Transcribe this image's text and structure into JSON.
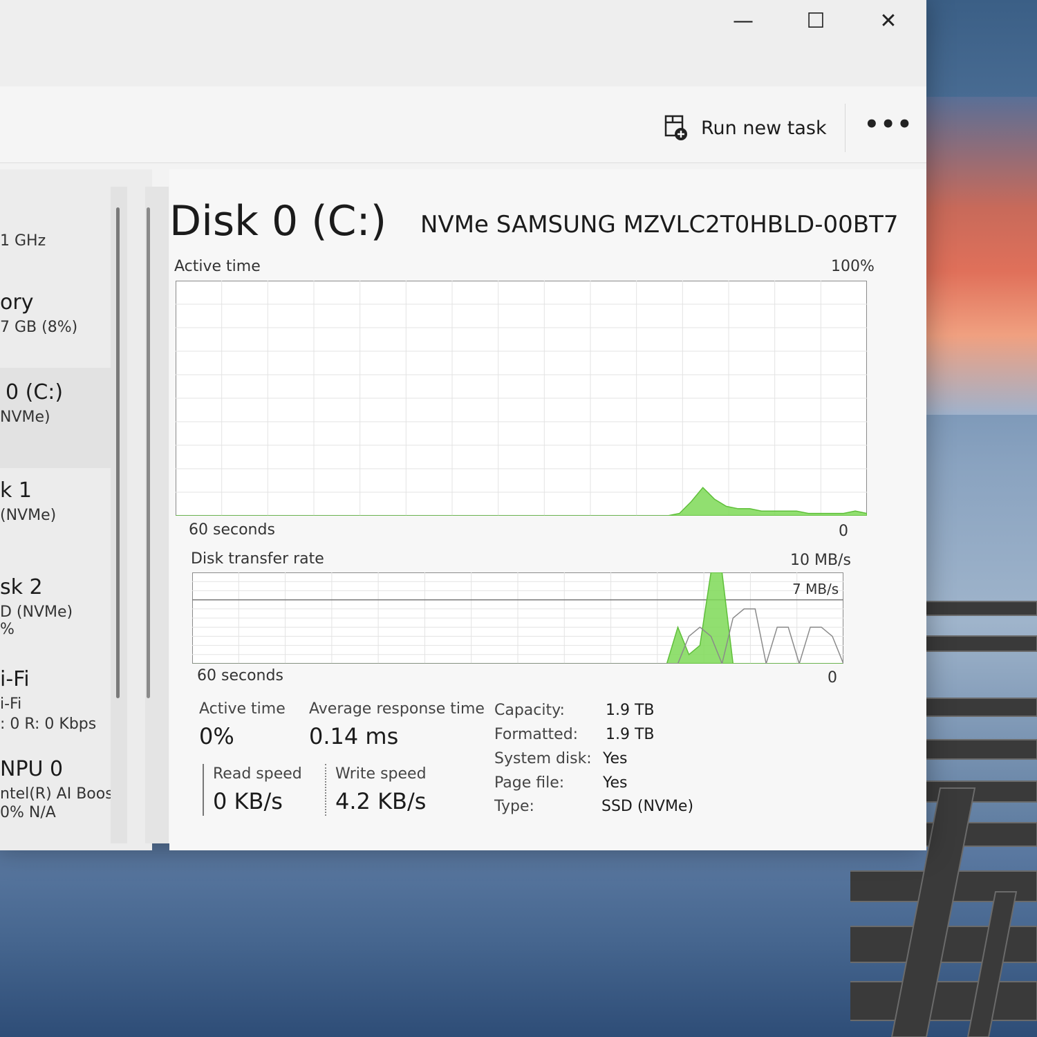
{
  "toolbar": {
    "run_new_task": "Run new task",
    "more": "•••"
  },
  "window_controls": {
    "minimize": "—",
    "maximize": "☐",
    "close": "✕"
  },
  "sidebar": {
    "items": [
      {
        "title": "",
        "sub": "1 GHz"
      },
      {
        "title": "ory",
        "sub": "7 GB (8%)"
      },
      {
        "title": "0 (C:)",
        "sub": "NVMe)"
      },
      {
        "title": "k 1",
        "sub": "(NVMe)"
      },
      {
        "title": "sk 2",
        "sub": "D (NVMe)",
        "sub2": "%"
      },
      {
        "title": "i-Fi",
        "sub": "i-Fi",
        "sub2": ": 0 R: 0 Kbps"
      },
      {
        "title": "NPU 0",
        "sub": "ntel(R) AI Boost",
        "sub2": "0% N/A"
      }
    ]
  },
  "header": {
    "title": "Disk 0 (C:)",
    "model": "NVMe SAMSUNG MZVLC2T0HBLD-00BT7"
  },
  "active_chart": {
    "label": "Active time",
    "max_label": "100%",
    "time_left": "60 seconds",
    "time_right": "0",
    "color": "#7ed957"
  },
  "transfer_chart": {
    "label": "Disk transfer rate",
    "max_label": "10 MB/s",
    "ref_label": "7 MB/s",
    "time_left": "60 seconds",
    "time_right": "0",
    "color": "#7ed957"
  },
  "stats": {
    "active_time_label": "Active time",
    "active_time_value": "0%",
    "avg_response_label": "Average response time",
    "avg_response_value": "0.14 ms",
    "read_label": "Read speed",
    "read_value": "0 KB/s",
    "write_label": "Write speed",
    "write_value": "4.2 KB/s"
  },
  "info": {
    "capacity_label": "Capacity:",
    "capacity_value": "1.9 TB",
    "formatted_label": "Formatted:",
    "formatted_value": "1.9 TB",
    "system_label": "System disk:",
    "system_value": "Yes",
    "pagefile_label": "Page file:",
    "pagefile_value": "Yes",
    "type_label": "Type:",
    "type_value": "SSD (NVMe)"
  },
  "chart_data": [
    {
      "type": "area",
      "title": "Active time",
      "ylim": [
        0,
        100
      ],
      "x_range_seconds": [
        60,
        0
      ],
      "values": [
        0,
        0,
        0,
        0,
        0,
        0,
        0,
        0,
        0,
        0,
        0,
        0,
        0,
        0,
        0,
        0,
        0,
        0,
        0,
        0,
        0,
        0,
        0,
        0,
        0,
        0,
        0,
        0,
        0,
        0,
        0,
        0,
        0,
        0,
        0,
        0,
        0,
        0,
        0,
        0,
        0,
        0,
        0,
        1,
        6,
        12,
        7,
        4,
        3,
        3,
        2,
        2,
        2,
        2,
        1,
        1,
        1,
        1,
        2,
        1
      ]
    },
    {
      "type": "area",
      "title": "Disk transfer rate",
      "ylim": [
        0,
        10
      ],
      "reference_line": 7,
      "x_range_seconds": [
        60,
        0
      ],
      "series": [
        {
          "values": [
            0,
            0,
            0,
            0,
            0,
            0,
            0,
            0,
            0,
            0,
            0,
            0,
            0,
            0,
            0,
            0,
            0,
            0,
            0,
            0,
            0,
            0,
            0,
            0,
            0,
            0,
            0,
            0,
            0,
            0,
            0,
            0,
            0,
            0,
            0,
            0,
            0,
            0,
            0,
            0,
            0,
            0,
            0,
            0,
            4,
            1,
            2,
            10,
            10,
            0,
            0,
            0,
            0,
            0,
            0,
            0,
            0,
            0,
            0,
            0
          ]
        },
        {
          "values": [
            0,
            0,
            0,
            0,
            0,
            0,
            0,
            0,
            0,
            0,
            0,
            0,
            0,
            0,
            0,
            0,
            0,
            0,
            0,
            0,
            0,
            0,
            0,
            0,
            0,
            0,
            0,
            0,
            0,
            0,
            0,
            0,
            0,
            0,
            0,
            0,
            0,
            0,
            0,
            0,
            0,
            0,
            0,
            0,
            0,
            3,
            4,
            3,
            0,
            5,
            6,
            6,
            0,
            4,
            4,
            0,
            4,
            4,
            3,
            0
          ]
        }
      ]
    }
  ]
}
